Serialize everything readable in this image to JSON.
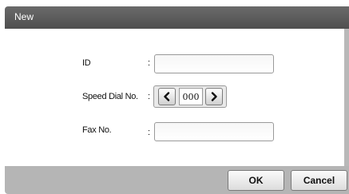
{
  "dialog": {
    "title": "New"
  },
  "form": {
    "id_label": "ID",
    "id_colon": ":",
    "id_value": "",
    "speed_dial_label": "Speed Dial No.",
    "speed_dial_colon": ":",
    "speed_dial_value": "000",
    "fax_label": "Fax No.",
    "fax_colon": ":",
    "fax_value": ""
  },
  "icons": {
    "decrement": "chevron-left-icon",
    "increment": "chevron-right-icon"
  },
  "buttons": {
    "ok_label": "OK",
    "cancel_label": "Cancel"
  }
}
